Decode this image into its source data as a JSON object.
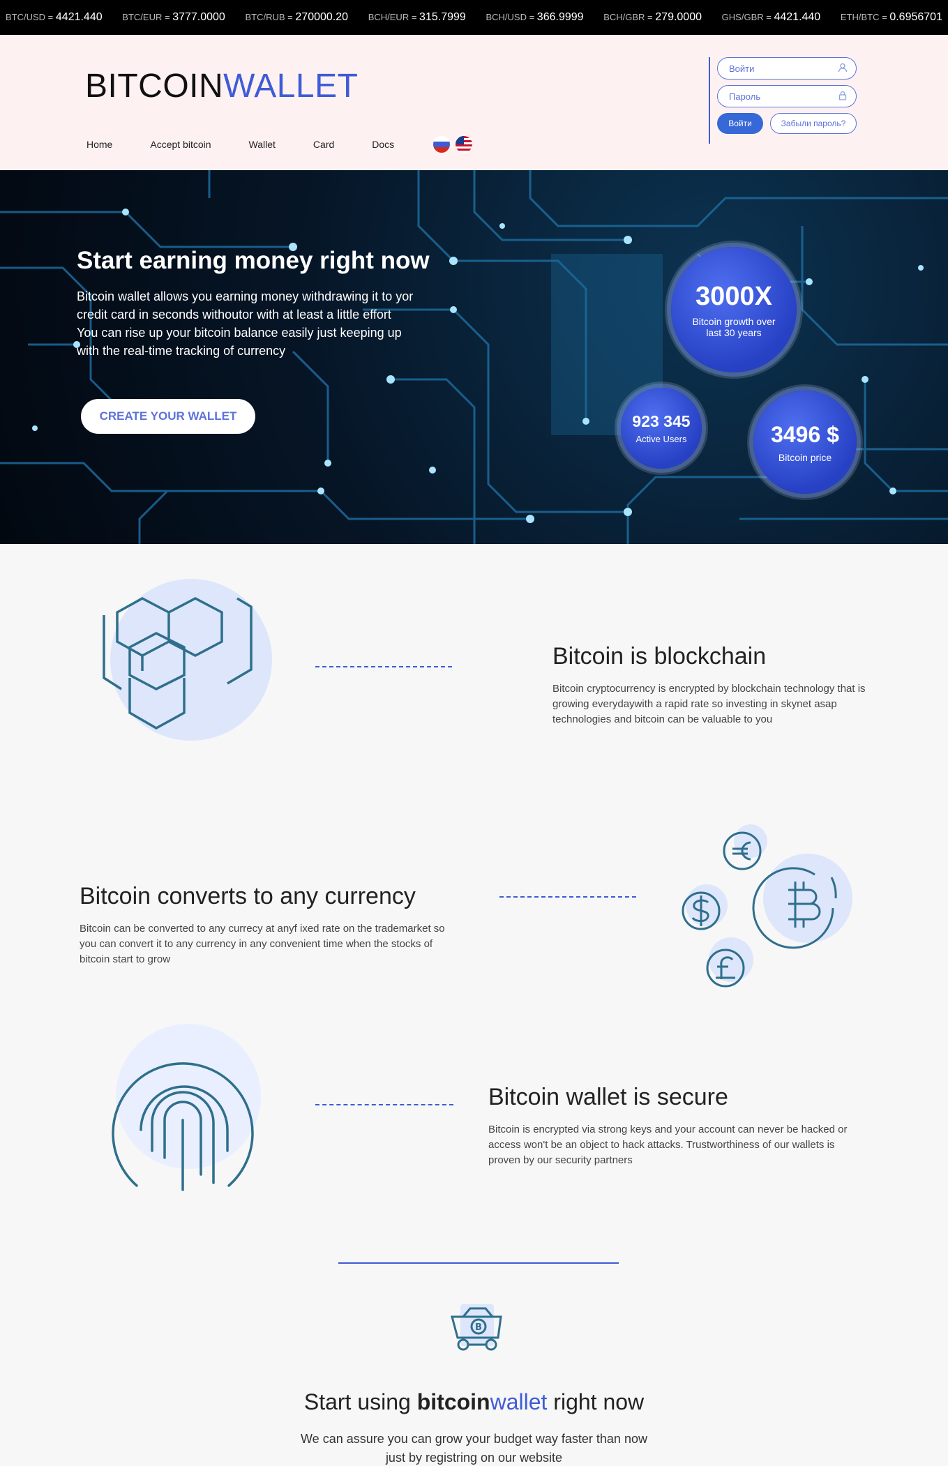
{
  "ticker": [
    {
      "pair": "BTC/USD",
      "value": "4421.440"
    },
    {
      "pair": "BTC/EUR",
      "value": "3777.0000"
    },
    {
      "pair": "BTC/RUB",
      "value": "270000.20"
    },
    {
      "pair": "BCH/EUR",
      "value": "315.7999"
    },
    {
      "pair": "BCH/USD",
      "value": "366.9999"
    },
    {
      "pair": "BCH/GBR",
      "value": "279.0000"
    },
    {
      "pair": "GHS/GBR",
      "value": "4421.440"
    },
    {
      "pair": "ETH/BTC",
      "value": "0.6956701"
    }
  ],
  "logo": {
    "part1": "BITCOIN",
    "part2": "WALLET"
  },
  "nav": [
    "Home",
    "Accept bitcoin",
    "Wallet",
    "Card",
    "Docs"
  ],
  "login": {
    "login_placeholder": "Войти",
    "password_placeholder": "Пароль",
    "submit_label": "Войти",
    "forgot_label": "Забыли пароль?"
  },
  "hero": {
    "title": "Start earning money right now",
    "lines": [
      "Bitcoin wallet allows you earning money withdrawing it to yor",
      "credit card in seconds withoutor with at least a little effort",
      "You can rise up your bitcoin balance easily just keeping up",
      "with the real-time tracking of currency"
    ],
    "cta": "CREATE YOUR WALLET",
    "stats": [
      {
        "value": "3000X",
        "label": "Bitcoin growth over last 30 years"
      },
      {
        "value": "923 345",
        "label": "Active Users"
      },
      {
        "value": "3496 $",
        "label": "Bitcoin price"
      }
    ]
  },
  "features": [
    {
      "title": "Bitcoin is blockchain",
      "text": "Bitcoin cryptocurrency is encrypted by blockchain technology that is growing everydaywith a rapid rate so investing in skynet asap technologies and bitcoin can be valuable to you",
      "icon": "hexagon-blocks-icon"
    },
    {
      "title": "Bitcoin converts to any currency",
      "text": "Bitcoin can be converted to any currecy at anyf ixed rate on the trademarket so you can convert it to any currency in any convenient time when the stocks of bitcoin start to grow",
      "icon": "currency-coins-icon"
    },
    {
      "title": "Bitcoin wallet is secure",
      "text": "Bitcoin is encrypted via strong keys and your account can never be hacked or access won't be an object to hack attacks. Trustworthiness of our wallets is proven by our security partners",
      "icon": "fingerprint-icon"
    }
  ],
  "cta": {
    "title_start": "Start using ",
    "title_bold": "bitcoin",
    "title_accent": "wallet",
    "title_end": " right now",
    "text_line1": "We can assure you can grow your budget way faster than now",
    "text_line2": "just by registring on our website",
    "icon": "bitcoin-cart-icon"
  },
  "colors": {
    "accent": "#3f5bd6",
    "header_bg": "#fdf2f1",
    "icon_stroke": "#2f6f8c",
    "icon_bg": "#dde6fb"
  }
}
